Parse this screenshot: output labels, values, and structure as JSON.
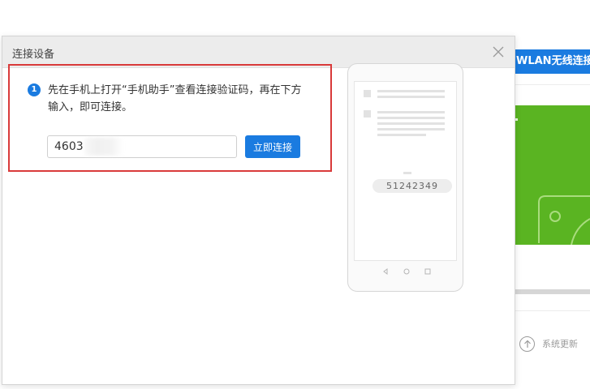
{
  "background": {
    "wlan_button": "WLAN无线连接",
    "system_update": "系统更新"
  },
  "dialog": {
    "title": "连接设备",
    "step_number": "1",
    "instruction": "先在手机上打开“手机助手”查看连接验证码，再在下方输入，即可连接。",
    "input_value": "4603",
    "connect_button": "立即连接",
    "phone_code": "51242349"
  },
  "colors": {
    "accent": "#1a7be0",
    "highlight_border": "#d93a3a",
    "green_panel": "#5ab422"
  },
  "icons": {
    "close": "close-icon",
    "step": "step-number-badge",
    "update": "arrow-up-circle-icon"
  }
}
